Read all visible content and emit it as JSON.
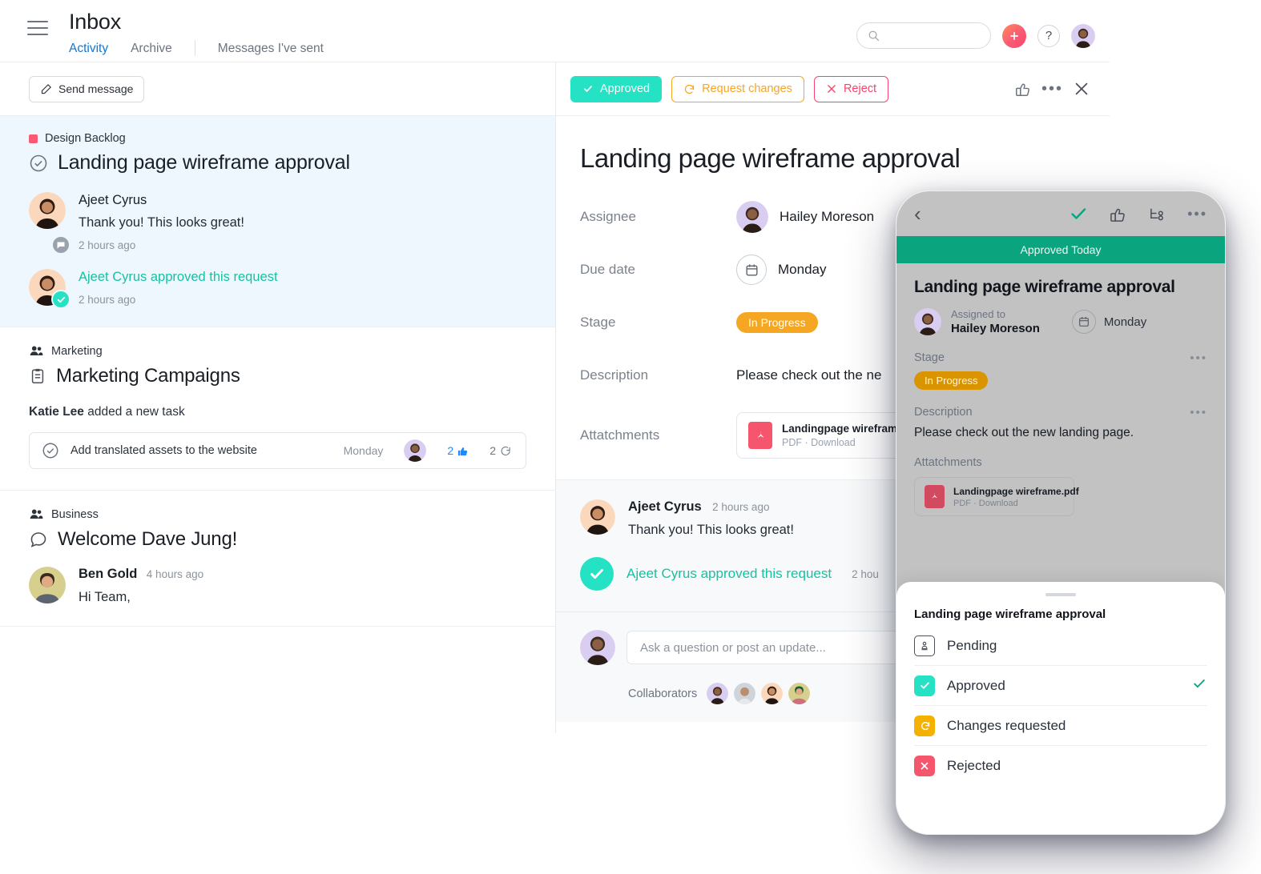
{
  "header": {
    "app_title": "Inbox",
    "menu_icon": "hamburger-icon",
    "tabs": [
      {
        "label": "Activity",
        "active": true
      },
      {
        "label": "Archive",
        "active": false
      },
      {
        "label": "Messages I've sent",
        "active": false
      }
    ],
    "search": {
      "value": "",
      "placeholder": "",
      "icon": "search-icon"
    },
    "create_button": {
      "label": "+",
      "icon": "plus-icon"
    },
    "help_button": {
      "label": "?",
      "icon": "question-icon"
    },
    "avatar": "user-avatar"
  },
  "inbox": {
    "send_message_label": "Send message",
    "items": [
      {
        "project": "Design Backlog",
        "project_color": "#fb5a74",
        "title": "Landing page wireframe approval",
        "selected": true,
        "messages": [
          {
            "author": "Ajeet Cyrus",
            "text": "Thank you! This looks great!",
            "time": "2 hours ago",
            "badge": "comment"
          },
          {
            "author": "Ajeet Cyrus approved this request",
            "text": "",
            "time": "2 hours ago",
            "badge": "approved"
          }
        ]
      },
      {
        "group": "Marketing",
        "title": "Marketing Campaigns",
        "actor": "Katie Lee",
        "action": "added a new task",
        "task": {
          "name": "Add translated assets to the website",
          "due": "Monday",
          "likes": "2",
          "comments": "2"
        }
      },
      {
        "group": "Business",
        "title": "Welcome Dave Jung!",
        "author": "Ben Gold",
        "time": "4 hours ago",
        "text": "Hi Team,"
      }
    ]
  },
  "detail": {
    "actions": {
      "approved": "Approved",
      "request_changes": "Request changes",
      "reject": "Reject",
      "like_icon": "thumbs-up-icon",
      "more_icon": "more-horizontal-icon",
      "close_icon": "close-icon"
    },
    "title": "Landing page wireframe approval",
    "fields": [
      {
        "label": "Assignee",
        "value": "Hailey Moreson",
        "type": "person"
      },
      {
        "label": "Due date",
        "value": "Monday",
        "type": "date"
      },
      {
        "label": "Stage",
        "value": "In Progress",
        "type": "pill"
      },
      {
        "label": "Description",
        "value": "Please check out the ne",
        "type": "text"
      },
      {
        "label": "Attatchments",
        "value": "",
        "type": "attachment"
      }
    ],
    "attachment": {
      "name": "Landingpage wireframe.pdf",
      "meta": "PDF · Download",
      "icon": "pdf-icon"
    },
    "comments": [
      {
        "author": "Ajeet Cyrus",
        "time": "2 hours ago",
        "text": "Thank you! This looks great!"
      }
    ],
    "approval_event": {
      "text": "Ajeet Cyrus approved this request",
      "time": "2 hou"
    },
    "composer": {
      "placeholder": "Ask a question or post an update...",
      "value": ""
    },
    "collaborators_label": "Collaborators",
    "collaborators": [
      "hailey",
      "dave",
      "ajeet",
      "ben"
    ]
  },
  "phone": {
    "nav": {
      "back_icon": "chevron-left-icon",
      "check_icon": "check-icon",
      "like_icon": "thumbs-up-icon",
      "subtask_icon": "subtask-icon",
      "more_icon": "more-horizontal-icon"
    },
    "banner": "Approved Today",
    "title": "Landing page wireframe approval",
    "assigned_label": "Assigned to",
    "assignee": "Hailey Moreson",
    "due": "Monday",
    "stage_label": "Stage",
    "stage_value": "In Progress",
    "description_label": "Description",
    "description_value": "Please check out the new landing page.",
    "attachments_label": "Attatchments",
    "attachment": {
      "name": "Landingpage wireframe.pdf",
      "meta": "PDF · Download"
    },
    "sheet": {
      "title": "Landing page wireframe approval",
      "options": [
        {
          "label": "Pending",
          "icon": "stamp-icon",
          "selected": false
        },
        {
          "label": "Approved",
          "icon": "check-square-icon",
          "selected": true
        },
        {
          "label": "Changes requested",
          "icon": "undo-square-icon",
          "selected": false
        },
        {
          "label": "Rejected",
          "icon": "x-square-icon",
          "selected": false
        }
      ]
    }
  },
  "colors": {
    "accent_blue": "#1576d1",
    "approved_teal": "#25e2c5",
    "warning_orange": "#f5a623",
    "reject_red": "#f5456c",
    "banner_green": "#0aa57f",
    "selected_bg": "#edf7fd"
  }
}
